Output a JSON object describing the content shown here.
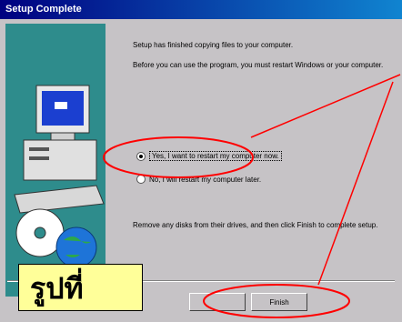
{
  "window": {
    "title": "Setup Complete"
  },
  "dialog": {
    "message1": "Setup has finished copying files to your computer.",
    "message2": "Before you can use the program, you must restart Windows or your computer.",
    "option_restart_now": "Yes, I want to restart my computer now.",
    "option_restart_later": "No, I will restart my computer later.",
    "message3": "Remove any disks from their drives, and then click Finish to complete setup.",
    "back_label": "",
    "finish_label": "Finish"
  },
  "annotation": {
    "caption": "รูปที่",
    "highlight_color": "#ff0000",
    "caption_bg": "#ffff99"
  },
  "colors": {
    "titlebar": "#000080",
    "dialog_bg": "#c6c3c6",
    "panel": "#2e8c8c"
  }
}
